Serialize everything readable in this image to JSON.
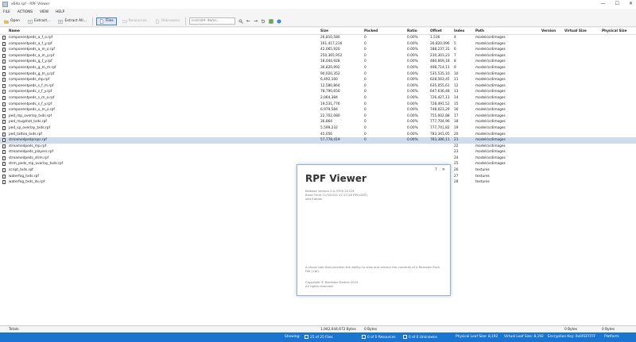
{
  "window": {
    "title": "x64o.rpf - RPF Viewer",
    "minimize": "—",
    "maximize": "☐",
    "close": "✕"
  },
  "menu": [
    "FILE",
    "ACTIONS",
    "VIEW",
    "HELP"
  ],
  "toolbar": {
    "open": "Open",
    "extract": "Extract...",
    "extract_all": "Extract All...",
    "files": "Files",
    "resources": "Resources",
    "unknowns": "Unknowns",
    "search_placeholder": "Find RPF Items..."
  },
  "columns": {
    "name": "Name",
    "size": "Size",
    "packed": "Packed",
    "ratio": "Ratio",
    "offset": "Offset",
    "index": "Index",
    "path": "Path",
    "version": "Version",
    "vsize": "Virtual Size",
    "psize": "Physical Size"
  },
  "rows": [
    {
      "name": "componentpeds_a_f_o.rpf",
      "size": "26,810,580",
      "packed": "0",
      "ratio": "0.00%",
      "offset": "1,536",
      "index": "4",
      "path": "models\\cdimages"
    },
    {
      "name": "componentpeds_a_f_y.rpf",
      "size": "161,417,216",
      "packed": "0",
      "ratio": "0.00%",
      "offset": "26,820,096",
      "index": "5",
      "path": "models\\cdimages"
    },
    {
      "name": "componentpeds_a_m_o.rpf",
      "size": "42,065,920",
      "packed": "0",
      "ratio": "0.00%",
      "offset": "188,237,31",
      "index": "6",
      "path": "models\\cdimages"
    },
    {
      "name": "componentpeds_a_m_y.rpf",
      "size": "250,365,952",
      "packed": "0",
      "ratio": "0.00%",
      "offset": "230,303,23",
      "index": "7",
      "path": "models\\cdimages"
    },
    {
      "name": "componentpeds_g_f_y.rpf",
      "size": "18,044,928",
      "packed": "0",
      "ratio": "0.00%",
      "offset": "480,669,18",
      "index": "8",
      "path": "models\\cdimages"
    },
    {
      "name": "componentpeds_g_m_m.rpf",
      "size": "36,820,992",
      "packed": "0",
      "ratio": "0.00%",
      "offset": "498,714,11",
      "index": "9",
      "path": "models\\cdimages"
    },
    {
      "name": "componentpeds_g_m_y.rpf",
      "size": "90,020,352",
      "packed": "0",
      "ratio": "0.00%",
      "offset": "535,535,10",
      "index": "10",
      "path": "models\\cdimages"
    },
    {
      "name": "componentpeds_mp.rpf",
      "size": "6,492,160",
      "packed": "0",
      "ratio": "0.00%",
      "offset": "628,563,45",
      "index": "11",
      "path": "models\\cdimages"
    },
    {
      "name": "componentpeds_s_f_m.rpf",
      "size": "12,580,864",
      "packed": "0",
      "ratio": "0.00%",
      "offset": "635,055,61",
      "index": "12",
      "path": "models\\cdimages"
    },
    {
      "name": "componentpeds_s_f_y.rpf",
      "size": "78,790,656",
      "packed": "0",
      "ratio": "0.00%",
      "offset": "647,636,48",
      "index": "13",
      "path": "models\\cdimages"
    },
    {
      "name": "componentpeds_s_m_o.rpf",
      "size": "2,064,384",
      "packed": "0",
      "ratio": "0.00%",
      "offset": "726,427,13",
      "index": "14",
      "path": "models\\cdimages"
    },
    {
      "name": "componentpeds_s_f_y.rpf",
      "size": "19,531,776",
      "packed": "0",
      "ratio": "0.00%",
      "offset": "728,491,52",
      "index": "15",
      "path": "models\\cdimages"
    },
    {
      "name": "componentpeds_u_m_o.rpf",
      "size": "6,979,584",
      "packed": "0",
      "ratio": "0.00%",
      "offset": "748,023,29",
      "index": "16",
      "path": "models\\cdimages"
    },
    {
      "name": "ped_mp_overlay_txds.rpf",
      "size": "22,702,080",
      "packed": "0",
      "ratio": "0.00%",
      "offset": "755,002,88",
      "index": "17",
      "path": "models\\cdimages"
    },
    {
      "name": "ped_mugshot_txds.rpf",
      "size": "36,864",
      "packed": "0",
      "ratio": "0.00%",
      "offset": "777,704,96",
      "index": "18",
      "path": "models\\cdimages"
    },
    {
      "name": "ped_sp_overlay_txds.rpf",
      "size": "5,599,232",
      "packed": "0",
      "ratio": "0.00%",
      "offset": "777,741,82",
      "index": "19",
      "path": "models\\cdimages"
    },
    {
      "name": "ped_tattoo_txds.rpf",
      "size": "45,056",
      "packed": "0",
      "ratio": "0.00%",
      "offset": "783,341,05",
      "index": "20",
      "path": "models\\cdimages"
    },
    {
      "name": "streamedpedprops.rpf",
      "size": "57,778,419",
      "packed": "0",
      "ratio": "0.00%",
      "offset": "783,386,11",
      "index": "21",
      "path": "models\\cdimages",
      "selected": true
    },
    {
      "name": "streamedpeds_mp.rpf",
      "size": "",
      "packed": "",
      "ratio": "",
      "offset": "",
      "index": "22",
      "path": "models\\cdimages"
    },
    {
      "name": "streamedpeds_players.rpf",
      "size": "",
      "packed": "",
      "ratio": "",
      "offset": "",
      "index": "23",
      "path": "models\\cdimages"
    },
    {
      "name": "streamedpeds_strm.rpf",
      "size": "",
      "packed": "",
      "ratio": "",
      "offset": "",
      "index": "24",
      "path": "models\\cdimages"
    },
    {
      "name": "strm_peds_mp_overlay_txds.rpf",
      "size": "",
      "packed": "",
      "ratio": "",
      "offset": "",
      "index": "25",
      "path": "models\\cdimages"
    },
    {
      "name": "script_txds.rpf",
      "size": "",
      "packed": "",
      "ratio": "",
      "offset": "",
      "index": "26",
      "path": "textures"
    },
    {
      "name": "waterfog_txds.rpf",
      "size": "",
      "packed": "",
      "ratio": "",
      "offset": "",
      "index": "27",
      "path": "textures"
    },
    {
      "name": "waterfog_txds_dx.rpf",
      "size": "",
      "packed": "",
      "ratio": "",
      "offset": "",
      "index": "28",
      "path": "textures"
    }
  ],
  "totals": {
    "label": "Totals:",
    "size": "1,942,044,672 Bytes",
    "packed": "0 Bytes",
    "vsize": "0 Bytes",
    "psize": "0 Bytes"
  },
  "status": {
    "showing": "Showing:",
    "files": "25 of 25 Files",
    "resources": "0 of 0 Resources",
    "unknowns": "0 of 0 Unknowns",
    "physical_leaf": "Physical Leaf Size: 8,192",
    "virtual_leaf": "Virtual Leaf Size: 8,192",
    "encryption": "Encryption Key: 0x0FEFFFFF",
    "platform": "Platform:"
  },
  "about": {
    "title": "RPF Viewer",
    "help": "?",
    "close": "✕",
    "version": "Release Version 5.0.3705.22129",
    "build": "Build Time 11/3/2015 12:17:28 PM (GMT)",
    "edition": "x64 Edition",
    "description": "A visual tool that provides the ability to view and extract the contents of a Rockstar Pack File (.rpf).",
    "copyright": "Copyright © Rockstar Games 2015",
    "rights": "All rights reserved."
  },
  "colors": {
    "accent": "#1a75d1",
    "selected_row": "#cfdcec"
  }
}
